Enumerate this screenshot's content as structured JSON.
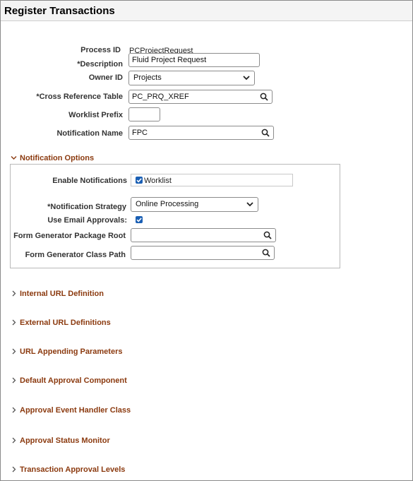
{
  "page": {
    "title": "Register Transactions"
  },
  "form": {
    "process_id": {
      "label": "Process ID",
      "value": "PCProjectRequest"
    },
    "description": {
      "label": "*Description",
      "value": "Fluid Project Request"
    },
    "owner_id": {
      "label": "Owner ID",
      "value": "Projects"
    },
    "cross_reference_table": {
      "label": "*Cross Reference Table",
      "value": "PC_PRQ_XREF"
    },
    "worklist_prefix": {
      "label": "Worklist Prefix",
      "value": ""
    },
    "notification_name": {
      "label": "Notification Name",
      "value": "FPC"
    }
  },
  "notification_options": {
    "title": "Notification Options",
    "expanded": true,
    "enable_notifications": {
      "label": "Enable Notifications",
      "option_label": "Worklist",
      "checked": true
    },
    "notification_strategy": {
      "label": "*Notification Strategy",
      "value": "Online Processing"
    },
    "use_email_approvals": {
      "label": "Use Email Approvals:",
      "checked": true
    },
    "form_generator_package_root": {
      "label": "Form Generator Package Root",
      "value": ""
    },
    "form_generator_class_path": {
      "label": "Form Generator Class Path",
      "value": ""
    }
  },
  "sections": [
    {
      "label": "Internal URL Definition",
      "expanded": false
    },
    {
      "label": "External URL Definitions",
      "expanded": false
    },
    {
      "label": "URL Appending Parameters",
      "expanded": false
    },
    {
      "label": "Default Approval Component",
      "expanded": false
    },
    {
      "label": "Approval Event Handler Class",
      "expanded": false
    },
    {
      "label": "Approval Status Monitor",
      "expanded": false
    },
    {
      "label": "Transaction Approval Levels",
      "expanded": false
    }
  ],
  "colors": {
    "section_header": "#8b3a0f",
    "checkbox": "#1a5fb4"
  },
  "icons": {
    "lookup": "search-icon",
    "dropdown": "chevron-down-icon",
    "collapsed": "chevron-right-icon",
    "expanded": "chevron-down-icon"
  }
}
